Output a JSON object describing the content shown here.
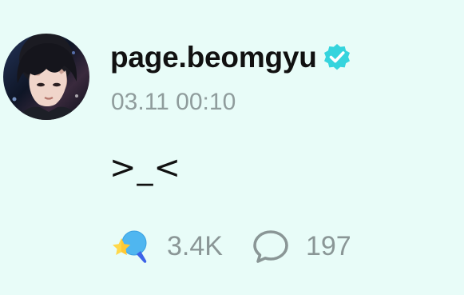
{
  "post": {
    "author": {
      "username": "page.beomgyu",
      "verified": true,
      "avatar_icon": "profile-photo"
    },
    "timestamp": "03.11 00:10",
    "body": ">_<",
    "actions": {
      "likes": {
        "count": "3.4K",
        "icon": "weverse-like-icon"
      },
      "comments": {
        "count": "197",
        "icon": "speech-bubble-icon"
      }
    }
  },
  "colors": {
    "background": "#e8fcf8",
    "username": "#111111",
    "verified_badge": "#35d4dd",
    "muted_text": "#8f9c9c"
  }
}
